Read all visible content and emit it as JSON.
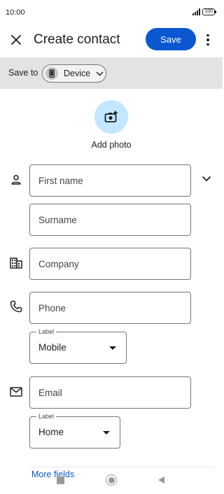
{
  "status_bar": {
    "time": "10:00",
    "battery": "100"
  },
  "header": {
    "title": "Create contact",
    "save_label": "Save"
  },
  "save_to": {
    "label": "Save to",
    "account": "Device"
  },
  "photo": {
    "label": "Add photo"
  },
  "fields": {
    "first_name": "First name",
    "surname": "Surname",
    "company": "Company",
    "phone": "Phone",
    "phone_label_legend": "Label",
    "phone_label_value": "Mobile",
    "email": "Email",
    "email_label_legend": "Label",
    "email_label_value": "Home"
  },
  "more_fields": "More fields",
  "colors": {
    "accent": "#0b57d0",
    "photo_bg": "#c2e7ff",
    "save_bar_bg": "#e2e3e3"
  },
  "icons": [
    "close-icon",
    "more-vert-icon",
    "phone-device-icon",
    "chevron-down-icon",
    "add-photo-icon",
    "person-icon",
    "business-icon",
    "phone-icon",
    "mail-icon",
    "expand-icon"
  ]
}
